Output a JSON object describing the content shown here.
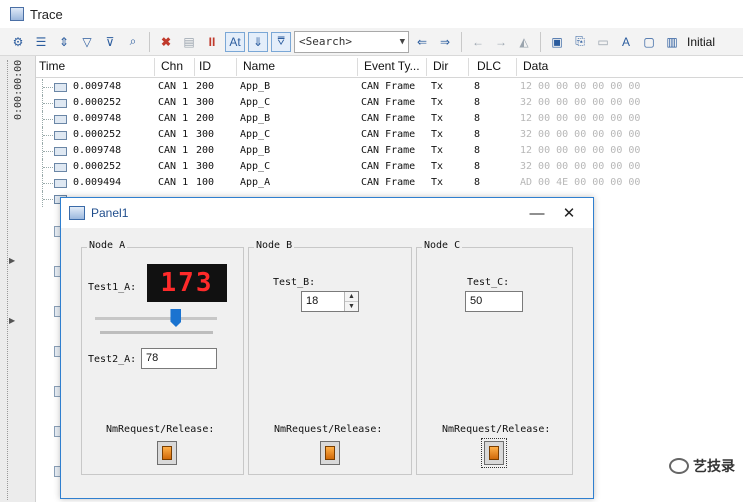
{
  "window": {
    "title": "Trace"
  },
  "toolbar": {
    "search_placeholder": "<Search>",
    "initial_label": "Initial",
    "at_label": "At",
    "pause_label": "II"
  },
  "gutter": {
    "time_label": "0:00:00:00"
  },
  "columns": [
    "Time",
    "Chn",
    "ID",
    "Name",
    "Event Ty...",
    "Dir",
    "DLC",
    "Data"
  ],
  "rows": [
    {
      "time": "0.009748",
      "chn": "CAN 1",
      "id": "200",
      "name": "App_B",
      "event": "CAN Frame",
      "dir": "Tx",
      "dlc": "8",
      "data": "12 00 00 00 00 00 00"
    },
    {
      "time": "0.000252",
      "chn": "CAN 1",
      "id": "300",
      "name": "App_C",
      "event": "CAN Frame",
      "dir": "Tx",
      "dlc": "8",
      "data": "32 00 00 00 00 00 00"
    },
    {
      "time": "0.009748",
      "chn": "CAN 1",
      "id": "200",
      "name": "App_B",
      "event": "CAN Frame",
      "dir": "Tx",
      "dlc": "8",
      "data": "12 00 00 00 00 00 00"
    },
    {
      "time": "0.000252",
      "chn": "CAN 1",
      "id": "300",
      "name": "App_C",
      "event": "CAN Frame",
      "dir": "Tx",
      "dlc": "8",
      "data": "32 00 00 00 00 00 00"
    },
    {
      "time": "0.009748",
      "chn": "CAN 1",
      "id": "200",
      "name": "App_B",
      "event": "CAN Frame",
      "dir": "Tx",
      "dlc": "8",
      "data": "12 00 00 00 00 00 00"
    },
    {
      "time": "0.000252",
      "chn": "CAN 1",
      "id": "300",
      "name": "App_C",
      "event": "CAN Frame",
      "dir": "Tx",
      "dlc": "8",
      "data": "32 00 00 00 00 00 00"
    },
    {
      "time": "0.009494",
      "chn": "CAN 1",
      "id": "100",
      "name": "App_A",
      "event": "CAN Frame",
      "dir": "Tx",
      "dlc": "8",
      "data": "AD 00 4E 00 00 00 00"
    }
  ],
  "panel": {
    "title": "Panel1",
    "minimize_label": "—",
    "close_label": "✕",
    "node_a": {
      "label": "Node A",
      "test1_label": "Test1_A:",
      "test1_display": "173",
      "slider_fraction": 0.68,
      "test2_label": "Test2_A:",
      "test2_value": "78",
      "nm_label": "NmRequest/Release:"
    },
    "node_b": {
      "label": "Node B",
      "test_label": "Test_B:",
      "test_value": "18",
      "spin_up": "▲",
      "spin_down": "▼",
      "nm_label": "NmRequest/Release:"
    },
    "node_c": {
      "label": "Node C",
      "test_label": "Test_C:",
      "test_value": "50",
      "nm_label": "NmRequest/Release:"
    }
  },
  "watermark": {
    "text": "艺技录"
  },
  "colors": {
    "led_red": "#ff2a2a",
    "accent_blue": "#1a73d0",
    "switch_orange": "#e8891f"
  }
}
